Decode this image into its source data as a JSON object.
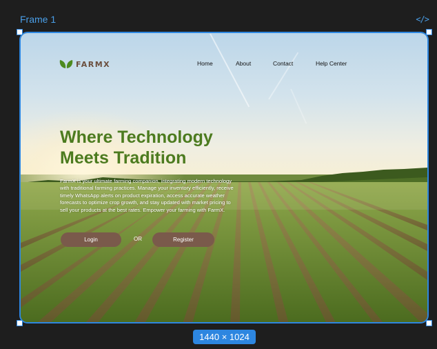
{
  "canvas": {
    "frame_label": "Frame 1",
    "code_icon": "</>",
    "size_badge": "1440 × 1024",
    "accent": "#2d86e0"
  },
  "site": {
    "logo": {
      "icon": "leaf-icon",
      "text": "FARMX",
      "color": "#6b4e3d",
      "leaf_color": "#4c8a1f"
    },
    "nav": [
      {
        "label": "Home"
      },
      {
        "label": "About"
      },
      {
        "label": "Contact"
      },
      {
        "label": "Help Center"
      }
    ],
    "hero": {
      "title_line1": "Where Technology",
      "title_line2": "Meets Tradition",
      "title_color": "#4c7b1f",
      "description": "FarmX is your ultimate farming companion, integrating modern technology with traditional farming practices. Manage your inventory efficiently, receive timely WhatsApp alerts on product expiration, access accurate weather forecasts to optimize crop growth, and stay updated with market pricing to sell your products at the best rates. Empower your farming with FarmX."
    },
    "actions": {
      "login_label": "Login",
      "or_label": "OR",
      "register_label": "Register",
      "button_color": "#7a5a4b"
    }
  }
}
